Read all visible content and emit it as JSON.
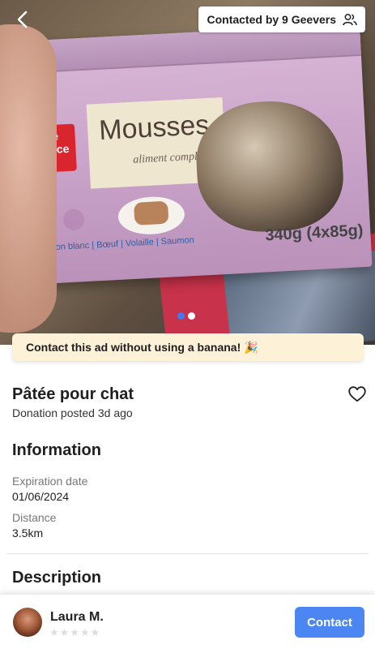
{
  "hero": {
    "back_icon": "chevron-left-icon",
    "contacted_label": "Contacted by 9 Geevers",
    "contacted_icon": "people-icon",
    "image_count": 2,
    "image_active_index": 0,
    "image_text": {
      "brand": "Belle France",
      "product": "Mousses",
      "subproduct": "aliment complet",
      "flavors": "Poisson blanc | Bœuf | Volaille | Saumon",
      "weight": "340g (4x85g)"
    }
  },
  "banner": {
    "text": "Contact this ad without using a banana! 🎉"
  },
  "listing": {
    "title": "Pâtée pour chat",
    "subtitle": "Donation posted 3d ago",
    "favorite_icon": "heart-outline-icon"
  },
  "information": {
    "heading": "Information",
    "expiration_label": "Expiration date",
    "expiration_value": "01/06/2024",
    "distance_label": "Distance",
    "distance_value": "3.5km"
  },
  "description": {
    "heading": "Description"
  },
  "seller": {
    "name": "Laura M.",
    "rating_stars": 0,
    "rating_max": 5
  },
  "actions": {
    "contact_label": "Contact"
  },
  "colors": {
    "accent": "#4b86f3",
    "banner_bg": "#fdf1d7",
    "active_dot": "#3c7bf0"
  }
}
